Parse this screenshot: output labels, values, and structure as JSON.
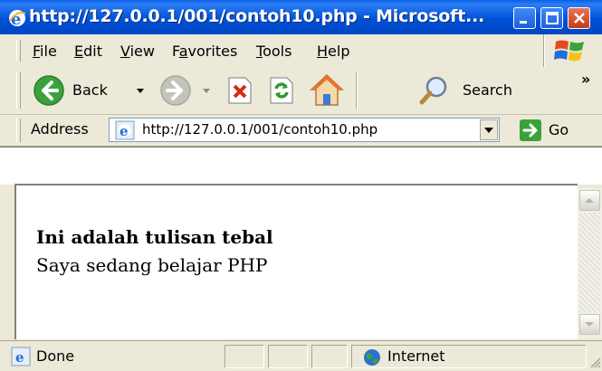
{
  "window": {
    "title": "http://127.0.0.1/001/contoh10.php - Microsoft..."
  },
  "menu": {
    "items": [
      {
        "label": "File",
        "hotkey": "F"
      },
      {
        "label": "Edit",
        "hotkey": "E"
      },
      {
        "label": "View",
        "hotkey": "V"
      },
      {
        "label": "Favorites",
        "hotkey": "a"
      },
      {
        "label": "Tools",
        "hotkey": "T"
      },
      {
        "label": "Help",
        "hotkey": "H"
      }
    ]
  },
  "toolbar": {
    "back_label": "Back",
    "search_label": "Search",
    "chevron": "»"
  },
  "address": {
    "label": "Address",
    "url": "http://127.0.0.1/001/contoh10.php",
    "go_label": "Go"
  },
  "page": {
    "bold_text": "Ini adalah tulisan tebal",
    "normal_text": "Saya sedang belajar PHP"
  },
  "status": {
    "text": "Done",
    "zone": "Internet"
  },
  "colors": {
    "titlebar": "#0054E3",
    "chrome": "#ECE9D8",
    "go": "#3BA23B"
  }
}
